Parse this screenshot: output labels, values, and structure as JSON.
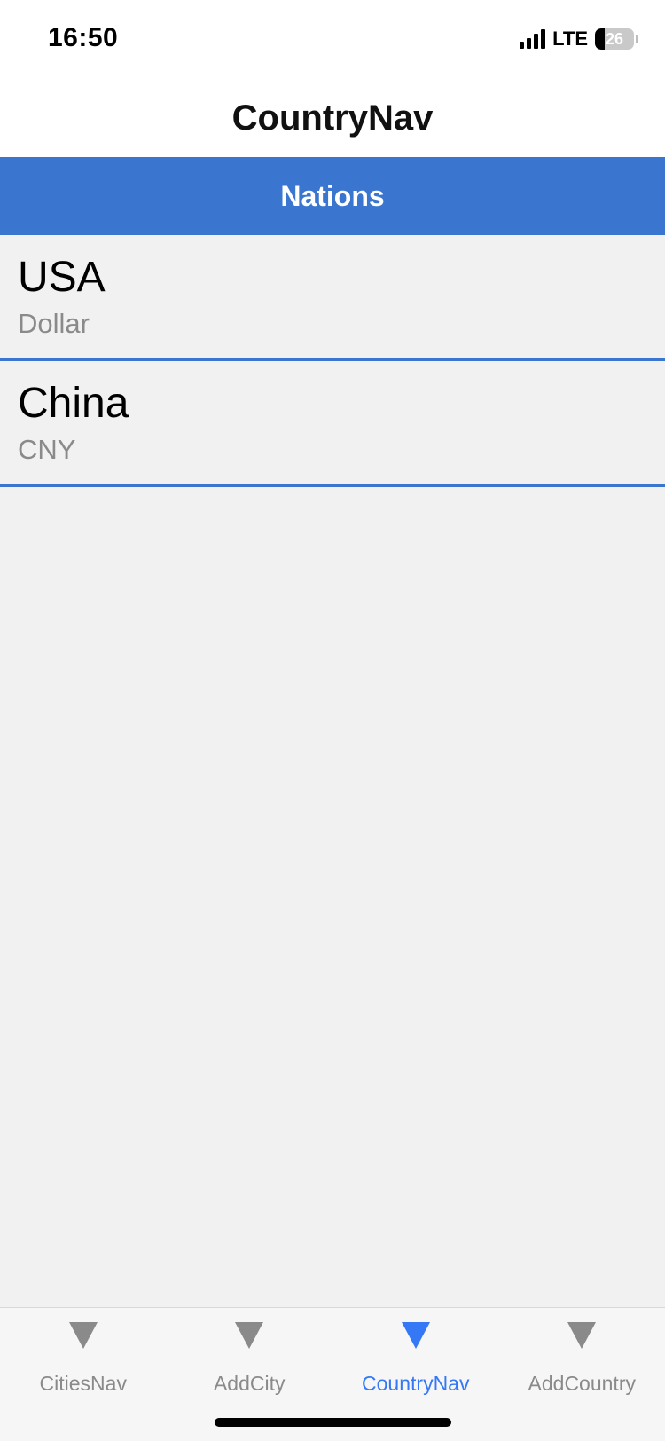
{
  "status_bar": {
    "time": "16:50",
    "network": "LTE",
    "battery_level": "26",
    "battery_percent": 26
  },
  "nav": {
    "title": "CountryNav"
  },
  "section": {
    "title": "Nations",
    "color": "#3a76cf"
  },
  "list": {
    "items": [
      {
        "title": "USA",
        "subtitle": "Dollar"
      },
      {
        "title": "China",
        "subtitle": "CNY"
      }
    ]
  },
  "tab_bar": {
    "active_color": "#3478f6",
    "inactive_color": "#8a8a8a",
    "tabs": [
      {
        "label": "CitiesNav",
        "icon": "triangle-down-icon",
        "active": false
      },
      {
        "label": "AddCity",
        "icon": "triangle-down-icon",
        "active": false
      },
      {
        "label": "CountryNav",
        "icon": "triangle-down-icon",
        "active": true
      },
      {
        "label": "AddCountry",
        "icon": "triangle-down-icon",
        "active": false
      }
    ]
  }
}
